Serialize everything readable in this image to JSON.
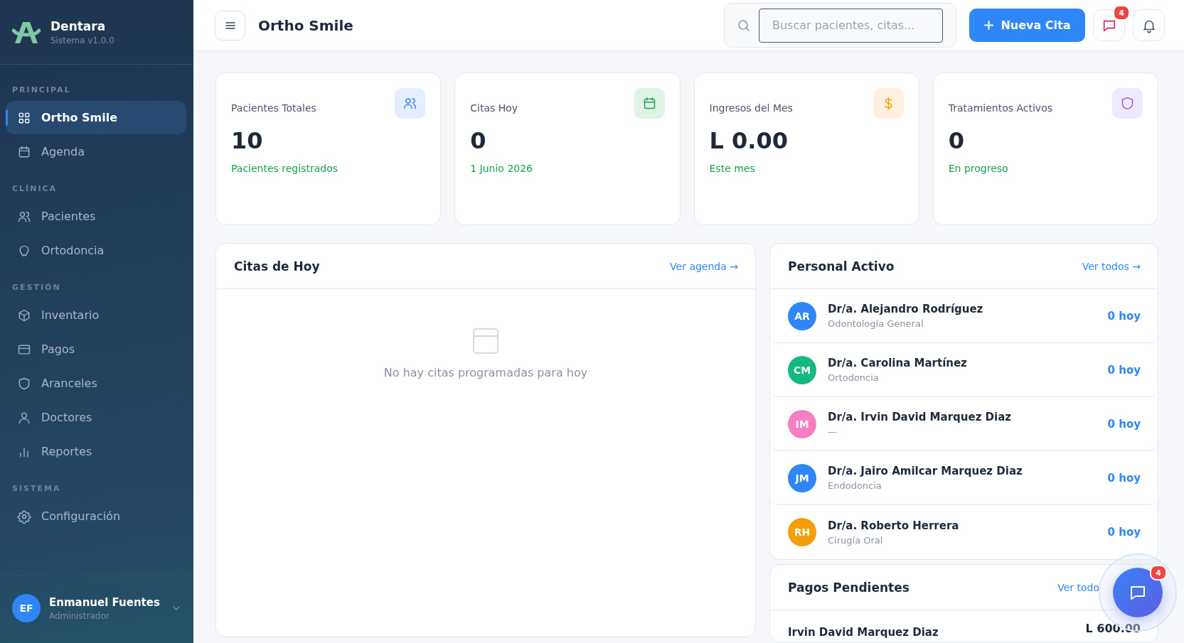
{
  "sidebar": {
    "brand": {
      "name": "Dentara",
      "version": "Sistema v1.0.0"
    },
    "sections": [
      {
        "title": "PRINCIPAL",
        "items": [
          {
            "label": "Ortho Smile",
            "selected": true
          },
          {
            "label": "Agenda",
            "selected": false
          }
        ]
      },
      {
        "title": "CLÍNICA",
        "items": [
          {
            "label": "Pacientes",
            "selected": false
          },
          {
            "label": "Ortodoncia",
            "selected": false
          }
        ]
      },
      {
        "title": "GESTIÓN",
        "items": [
          {
            "label": "Inventario",
            "selected": false
          },
          {
            "label": "Pagos",
            "selected": false
          },
          {
            "label": "Aranceles",
            "selected": false
          },
          {
            "label": "Doctores",
            "selected": false
          },
          {
            "label": "Reportes",
            "selected": false
          }
        ]
      },
      {
        "title": "SISTEMA",
        "items": [
          {
            "label": "Configuración",
            "selected": false
          }
        ]
      }
    ],
    "user": {
      "initials": "EF",
      "name": "Enmanuel Fuentes",
      "role": "Administrador"
    }
  },
  "header": {
    "title": "Ortho Smile",
    "search": {
      "placeholder": "Buscar pacientes, citas..."
    },
    "new_button": "Nueva Cita",
    "messages_badge": "4"
  },
  "stats": [
    {
      "label": "Pacientes Totales",
      "value": "10",
      "note": "Pacientes registrados",
      "color": "#3b82f6"
    },
    {
      "label": "Citas Hoy",
      "value": "0",
      "note": "1 Junio 2026",
      "color": "#16a34a"
    },
    {
      "label": "Ingresos del Mes",
      "value": "L 0.00",
      "note": "Este mes",
      "color": "#f59e0b"
    },
    {
      "label": "Tratamientos Activos",
      "value": "0",
      "note": "En progreso",
      "color": "#8b5cf6"
    }
  ],
  "appointments": {
    "title": "Citas de Hoy",
    "link": "Ver agenda →",
    "empty": "No hay citas programadas para hoy"
  },
  "staff": {
    "title": "Personal Activo",
    "link": "Ver todos →",
    "members": [
      {
        "initials": "AR",
        "name": "Dr/a. Alejandro Rodríguez",
        "specialty": "Odontología General",
        "today": "0 hoy",
        "color": "#2f86f6"
      },
      {
        "initials": "CM",
        "name": "Dr/a. Carolina Martínez",
        "specialty": "Ortodoncia",
        "today": "0 hoy",
        "color": "#12b981"
      },
      {
        "initials": "IM",
        "name": "Dr/a. Irvin David Marquez Diaz",
        "specialty": "—",
        "today": "0 hoy",
        "color": "#f57fbf"
      },
      {
        "initials": "JM",
        "name": "Dr/a. Jairo Amilcar Marquez Diaz",
        "specialty": "Endodoncia",
        "today": "0 hoy",
        "color": "#2f86f6"
      },
      {
        "initials": "RH",
        "name": "Dr/a. Roberto Herrera",
        "specialty": "Cirugía Oral",
        "today": "0 hoy",
        "color": "#f59e0b"
      }
    ]
  },
  "payments": {
    "title": "Pagos Pendientes",
    "link": "Ver todo",
    "rows": [
      {
        "name": "Irvin David Marquez Diaz",
        "amount": "L 600.00"
      }
    ]
  },
  "chat_fab": {
    "badge": "4"
  }
}
